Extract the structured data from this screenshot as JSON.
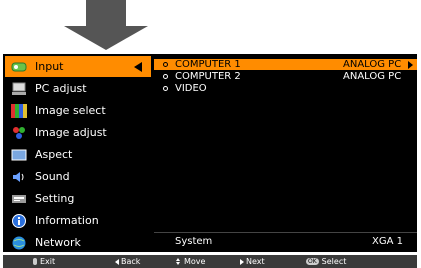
{
  "sidebar": {
    "items": [
      {
        "label": "Input"
      },
      {
        "label": "PC adjust"
      },
      {
        "label": "Image select"
      },
      {
        "label": "Image adjust"
      },
      {
        "label": "Aspect"
      },
      {
        "label": "Sound"
      },
      {
        "label": "Setting"
      },
      {
        "label": "Information"
      },
      {
        "label": "Network"
      }
    ]
  },
  "main": {
    "options": [
      {
        "name": "COMPUTER 1",
        "value": "ANALOG PC"
      },
      {
        "name": "COMPUTER 2",
        "value": "ANALOG PC"
      },
      {
        "name": "VIDEO",
        "value": ""
      }
    ],
    "status_label": "System",
    "status_value": "XGA 1"
  },
  "bottom_bar": {
    "exit_key": "",
    "exit_label": "Exit",
    "back_label": "Back",
    "move_label": "Move",
    "next_label": "Next",
    "select_key": "OK",
    "select_label": "Select"
  },
  "colors": {
    "highlight": "#ff8c00",
    "panel_bg": "#000000",
    "bottom_bg": "#3a3a3a"
  }
}
